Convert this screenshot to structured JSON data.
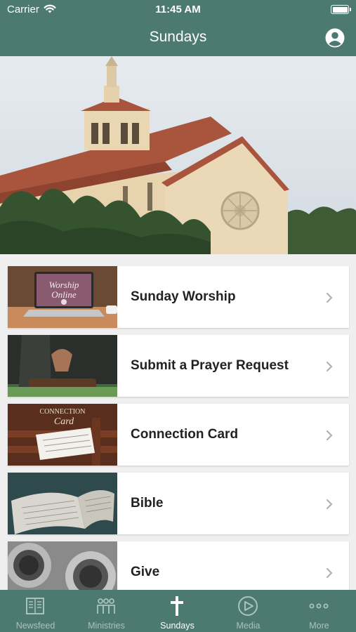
{
  "status_bar": {
    "carrier": "Carrier",
    "time": "11:45 AM"
  },
  "nav": {
    "title": "Sundays"
  },
  "hero": {
    "icon": "church-photo"
  },
  "menu": [
    {
      "label": "Sunday Worship",
      "thumb": "worship-online-laptop",
      "thumb_text_1": "Worship",
      "thumb_text_2": "Online"
    },
    {
      "label": "Submit a Prayer Request",
      "thumb": "praying-hands"
    },
    {
      "label": "Connection Card",
      "thumb": "connection-card-pew",
      "thumb_text_1": "CONNECTION",
      "thumb_text_2": "Card"
    },
    {
      "label": "Bible",
      "thumb": "open-bible"
    },
    {
      "label": "Give",
      "thumb": "offering-plates"
    }
  ],
  "tabs": [
    {
      "label": "Newsfeed",
      "icon": "newspaper-icon",
      "active": false
    },
    {
      "label": "Ministries",
      "icon": "people-icon",
      "active": false
    },
    {
      "label": "Sundays",
      "icon": "cross-icon",
      "active": true
    },
    {
      "label": "Media",
      "icon": "play-icon",
      "active": false
    },
    {
      "label": "More",
      "icon": "more-dots-icon",
      "active": false
    }
  ],
  "colors": {
    "brand": "#4d7a70",
    "tab_inactive": "#a9c2bc",
    "background": "#efefef"
  }
}
